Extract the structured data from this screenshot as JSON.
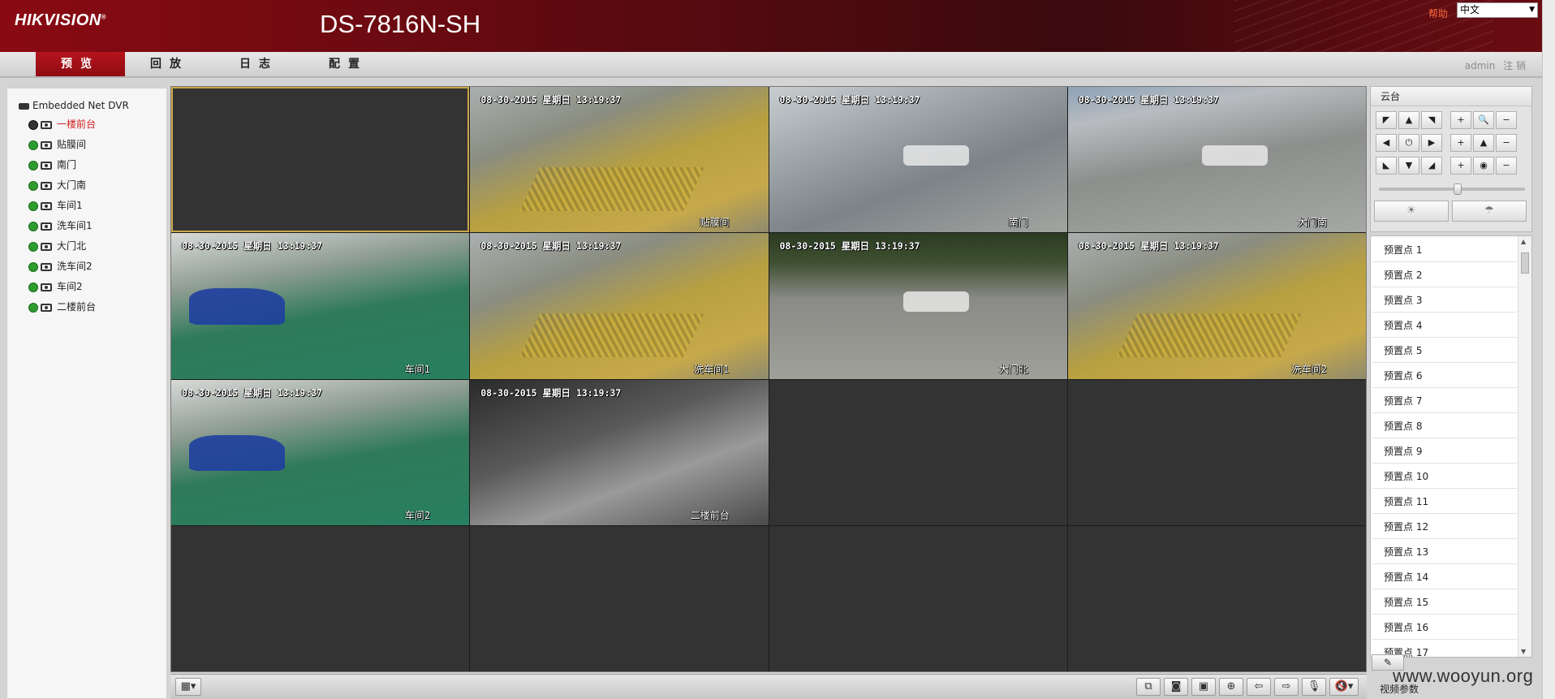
{
  "header": {
    "brand": "HIKVISION",
    "brand_mark": "®",
    "device_model": "DS-7816N-SH",
    "help_label": "帮助",
    "language": "中文"
  },
  "nav": {
    "tabs": [
      {
        "label": "预览",
        "active": true
      },
      {
        "label": "回放",
        "active": false
      },
      {
        "label": "日志",
        "active": false
      },
      {
        "label": "配置",
        "active": false
      }
    ],
    "user": "admin",
    "logout_label": "注 销"
  },
  "tree": {
    "root_label": "Embedded Net DVR",
    "channels": [
      {
        "label": "一楼前台",
        "selected": true
      },
      {
        "label": "贴膜间",
        "selected": false
      },
      {
        "label": "南门",
        "selected": false
      },
      {
        "label": "大门南",
        "selected": false
      },
      {
        "label": "车间1",
        "selected": false
      },
      {
        "label": "洗车间1",
        "selected": false
      },
      {
        "label": "大门北",
        "selected": false
      },
      {
        "label": "洗车间2",
        "selected": false
      },
      {
        "label": "车间2",
        "selected": false
      },
      {
        "label": "二楼前台",
        "selected": false
      }
    ]
  },
  "grid": {
    "cells": [
      {
        "osd_time": "",
        "osd_name": ""
      },
      {
        "osd_time": "08-30-2015 星期日 13:19:37",
        "osd_name": "贴膜间"
      },
      {
        "osd_time": "08-30-2015 星期日 13:19:37",
        "osd_name": "南门"
      },
      {
        "osd_time": "08-30-2015 星期日 13:19:37",
        "osd_name": "大门南"
      },
      {
        "osd_time": "08-30-2015 星期日 13:19:37",
        "osd_name": "车间1"
      },
      {
        "osd_time": "08-30-2015 星期日 13:19:37",
        "osd_name": "洗车间1"
      },
      {
        "osd_time": "08-30-2015 星期日 13:19:37",
        "osd_name": "大门北"
      },
      {
        "osd_time": "08-30-2015 星期日 13:19:37",
        "osd_name": "洗车间2"
      },
      {
        "osd_time": "08-30-2015 星期日 13:19:37",
        "osd_name": "车间2"
      },
      {
        "osd_time": "08-30-2015 星期日 13:19:37",
        "osd_name": "二楼前台"
      }
    ]
  },
  "ptz": {
    "title": "云台"
  },
  "presets": [
    "预置点 1",
    "预置点 2",
    "预置点 3",
    "预置点 4",
    "预置点 5",
    "预置点 6",
    "预置点 7",
    "预置点 8",
    "预置点 9",
    "预置点 10",
    "预置点 11",
    "预置点 12",
    "预置点 13",
    "预置点 14",
    "预置点 15",
    "预置点 16",
    "预置点 17"
  ],
  "footer": {
    "video_params_label": "视频参数",
    "watermark": "www.wooyun.org"
  }
}
